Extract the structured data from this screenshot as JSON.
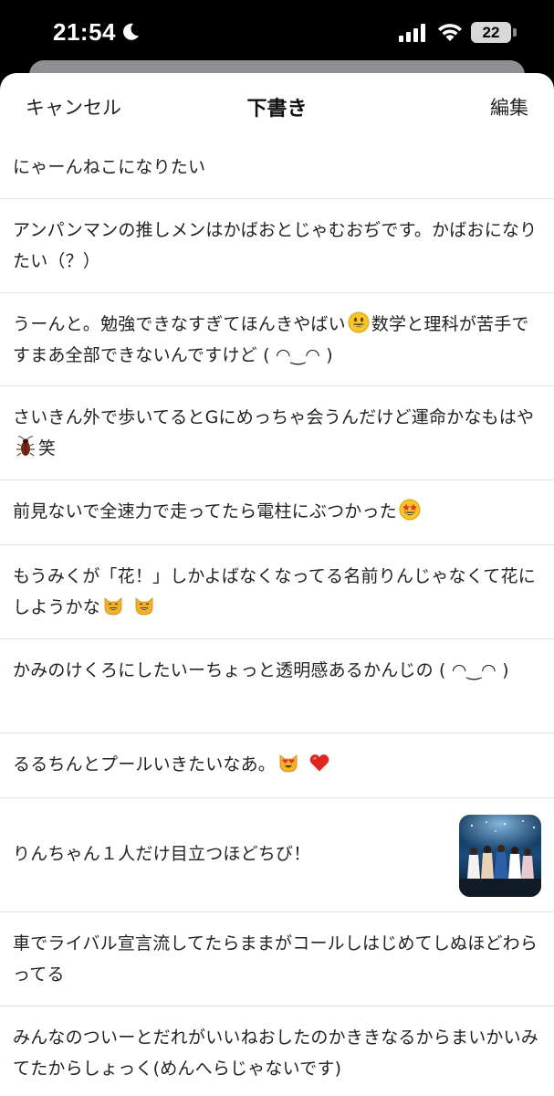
{
  "status_bar": {
    "time": "21:54",
    "battery": "22",
    "icons": [
      "moon-icon",
      "signal-icon",
      "wifi-icon",
      "battery-icon"
    ]
  },
  "nav": {
    "cancel_label": "キャンセル",
    "title": "下書き",
    "edit_label": "編集"
  },
  "drafts": [
    {
      "text": "にゃーんねこになりたい"
    },
    {
      "text": "アンパンマンの推しメンはかばおとじゃむおぢです。かばおになりたい（？）"
    },
    {
      "text_before": "うーんと。勉強できなすぎてほんきやばい",
      "emoji": "smiley-emoji",
      "text_after": "数学と理科が苦手ですまあ全部できないんですけど ( ◠‿◠ )"
    },
    {
      "text_before": "さいきん外で歩いてるとGにめっちゃ会うんだけど運命かなもはや",
      "emoji": "cockroach-emoji",
      "text_after": "笑"
    },
    {
      "text_before": "前見ないで全速力で走ってたら電柱にぶつかった",
      "emoji": "star-struck-emoji",
      "text_after": ""
    },
    {
      "text_before": "もうみくが「花！」しかよばなくなってる名前りんじゃなくて花にしようかな",
      "emoji": "smiling-cat-emoji",
      "text_after": ""
    },
    {
      "text": "かみのけくろにしたいーちょっと透明感あるかんじの ( ◠‿◠ )"
    },
    {
      "text_before": "るるちんとプールいきたいなあ。",
      "emoji": "heart-eyes-cat-emoji",
      "text_after": ""
    },
    {
      "text": "りんちゃん１人だけ目立つほどちび！",
      "has_image": true
    },
    {
      "text": "車でライバル宣言流してたらままがコールしはじめてしぬほどわらってる"
    },
    {
      "text": "みんなのついーとだれがいいねおしたのかききなるからまいかいみてたからしょっく(めんへらじゃないです)"
    }
  ]
}
